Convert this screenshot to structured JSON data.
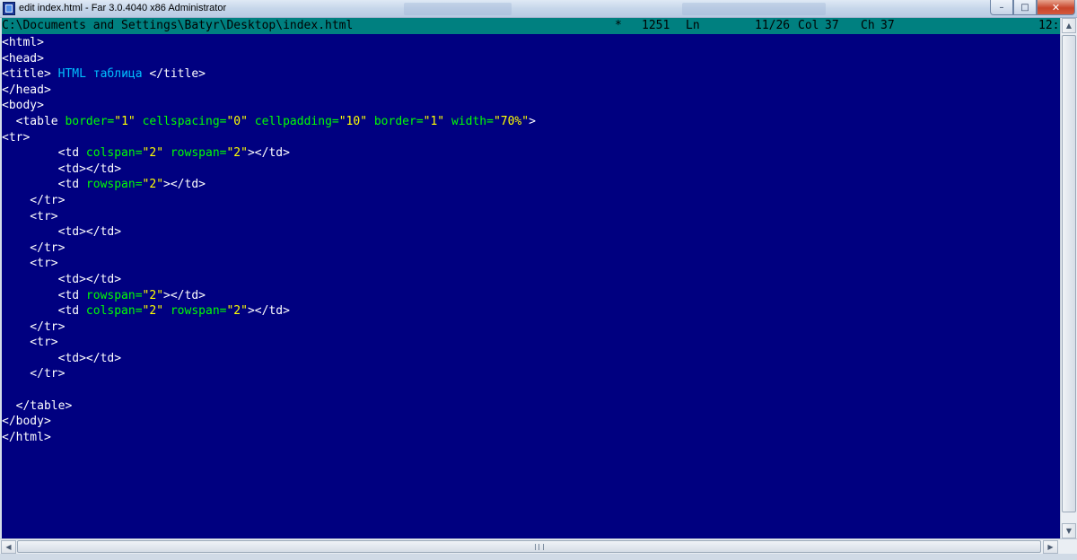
{
  "window": {
    "title": "edit index.html - Far 3.0.4040 x86 Administrator",
    "controls": {
      "minimize": "–",
      "maximize": "□",
      "close": "✕"
    }
  },
  "status": {
    "path": "C:\\Documents and Settings\\Batyr\\Desktop\\index.html",
    "modified": "*",
    "codepage": "1251",
    "ln_label": "Ln",
    "line_pos": "11/26",
    "col_label": "Col",
    "col_value": "37",
    "ch_label": "Ch",
    "ch_value": "37",
    "clock": "12:"
  },
  "code_lines": [
    [
      {
        "t": "tag",
        "v": "<html>"
      }
    ],
    [
      {
        "t": "tag",
        "v": "<head>"
      }
    ],
    [
      {
        "t": "tag",
        "v": "<title>"
      },
      {
        "t": "text",
        "v": " HTML таблица "
      },
      {
        "t": "tag",
        "v": "</title>"
      }
    ],
    [
      {
        "t": "tag",
        "v": "</head>"
      }
    ],
    [
      {
        "t": "tag",
        "v": "<body>"
      }
    ],
    [
      {
        "t": "tag",
        "v": "  <table "
      },
      {
        "t": "attr",
        "v": "border="
      },
      {
        "t": "val",
        "v": "\"1\""
      },
      {
        "t": "tag",
        "v": " "
      },
      {
        "t": "attr",
        "v": "cellspacing="
      },
      {
        "t": "val",
        "v": "\"0\""
      },
      {
        "t": "tag",
        "v": " "
      },
      {
        "t": "attr",
        "v": "cellpadding="
      },
      {
        "t": "val",
        "v": "\"10\""
      },
      {
        "t": "tag",
        "v": " "
      },
      {
        "t": "attr",
        "v": "border="
      },
      {
        "t": "val",
        "v": "\"1\""
      },
      {
        "t": "tag",
        "v": " "
      },
      {
        "t": "attr",
        "v": "width="
      },
      {
        "t": "val",
        "v": "\"70%\""
      },
      {
        "t": "tag",
        "v": ">"
      }
    ],
    [
      {
        "t": "tag",
        "v": "<tr>"
      }
    ],
    [
      {
        "t": "tag",
        "v": "        <td "
      },
      {
        "t": "attr",
        "v": "colspan="
      },
      {
        "t": "val",
        "v": "\"2\""
      },
      {
        "t": "tag",
        "v": " "
      },
      {
        "t": "attr",
        "v": "rowspan="
      },
      {
        "t": "val",
        "v": "\"2\""
      },
      {
        "t": "tag",
        "v": "></td>"
      }
    ],
    [
      {
        "t": "tag",
        "v": "        <td></td>"
      }
    ],
    [
      {
        "t": "tag",
        "v": "        <td "
      },
      {
        "t": "attr",
        "v": "rowspan="
      },
      {
        "t": "val",
        "v": "\"2\""
      },
      {
        "t": "tag",
        "v": "></td>"
      }
    ],
    [
      {
        "t": "tag",
        "v": "    </tr>"
      }
    ],
    [
      {
        "t": "tag",
        "v": "    <tr>"
      }
    ],
    [
      {
        "t": "tag",
        "v": "        <td></td>"
      }
    ],
    [
      {
        "t": "tag",
        "v": "    </tr>"
      }
    ],
    [
      {
        "t": "tag",
        "v": "    <tr>"
      }
    ],
    [
      {
        "t": "tag",
        "v": "        <td></td>"
      }
    ],
    [
      {
        "t": "tag",
        "v": "        <td "
      },
      {
        "t": "attr",
        "v": "rowspan="
      },
      {
        "t": "val",
        "v": "\"2\""
      },
      {
        "t": "tag",
        "v": "></td>"
      }
    ],
    [
      {
        "t": "tag",
        "v": "        <td "
      },
      {
        "t": "attr",
        "v": "colspan="
      },
      {
        "t": "val",
        "v": "\"2\""
      },
      {
        "t": "tag",
        "v": " "
      },
      {
        "t": "attr",
        "v": "rowspan="
      },
      {
        "t": "val",
        "v": "\"2\""
      },
      {
        "t": "tag",
        "v": "></td>"
      }
    ],
    [
      {
        "t": "tag",
        "v": "    </tr>"
      }
    ],
    [
      {
        "t": "tag",
        "v": "    <tr>"
      }
    ],
    [
      {
        "t": "tag",
        "v": "        <td></td>"
      }
    ],
    [
      {
        "t": "tag",
        "v": "    </tr>"
      }
    ],
    [
      {
        "t": "tag",
        "v": ""
      }
    ],
    [
      {
        "t": "tag",
        "v": "  </table>"
      }
    ],
    [
      {
        "t": "tag",
        "v": "</body>"
      }
    ],
    [
      {
        "t": "tag",
        "v": "</html>"
      }
    ]
  ],
  "colors": {
    "editor_bg": "#000080",
    "status_bg": "#008080",
    "tag": "#ffffff",
    "attr": "#00ff00",
    "value": "#ffff00",
    "text": "#00c0ff"
  },
  "icons": {
    "app": "far-manager-icon",
    "scroll_up": "scroll-up-arrow-icon",
    "scroll_down": "scroll-down-arrow-icon",
    "scroll_left": "scroll-left-arrow-icon",
    "scroll_right": "scroll-right-arrow-icon"
  }
}
